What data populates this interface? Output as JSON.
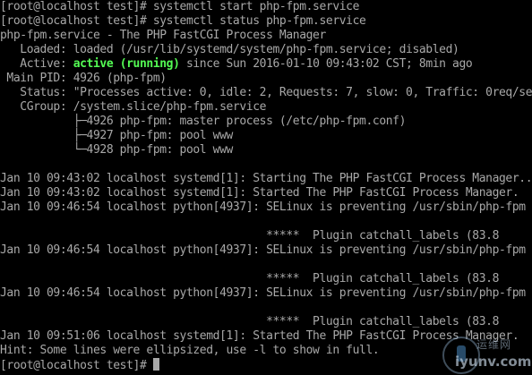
{
  "terminal": {
    "lines": [
      "[root@localhost test]# systemctl start php-fpm.service",
      "[root@localhost test]# systemctl status php-fpm.service",
      "php-fpm.service - The PHP FastCGI Process Manager",
      "   Loaded: loaded (/usr/lib/systemd/system/php-fpm.service; disabled)",
      "   Active: ",
      " Main PID: 4926 (php-fpm)",
      "   Status: \"Processes active: 0, idle: 2, Requests: 7, slow: 0, Traffic: 0req/sec\"",
      "   CGroup: /system.slice/php-fpm.service",
      "           ├─4926 php-fpm: master process (/etc/php-fpm.conf)",
      "           ├─4927 php-fpm: pool www",
      "           └─4928 php-fpm: pool www",
      "",
      "Jan 10 09:43:02 localhost systemd[1]: Starting The PHP FastCGI Process Manager...",
      "Jan 10 09:43:02 localhost systemd[1]: Started The PHP FastCGI Process Manager.",
      "Jan 10 09:46:54 localhost python[4937]: SELinux is preventing /usr/sbin/php-fpm",
      "",
      "                                        *****  Plugin catchall_labels (83.8",
      "Jan 10 09:46:54 localhost python[4937]: SELinux is preventing /usr/sbin/php-fpm",
      "",
      "                                        *****  Plugin catchall_labels (83.8",
      "Jan 10 09:46:54 localhost python[4937]: SELinux is preventing /usr/sbin/php-fpm",
      "",
      "                                        *****  Plugin catchall_labels (83.8",
      "Jan 10 09:51:06 localhost systemd[1]: Started The PHP FastCGI Process Manager.",
      "Hint: Some lines were ellipsized, use -l to show in full.",
      "[root@localhost test]# "
    ],
    "active_state": "active (running)",
    "active_since": " since Sun 2016-01-10 09:43:02 CST; 8min ago"
  },
  "colors": {
    "background": "#000000",
    "text": "#a8a8a8",
    "active_green": "#54fc54"
  },
  "watermark": {
    "chinese": "运维网",
    "english": "iyunv.com"
  }
}
